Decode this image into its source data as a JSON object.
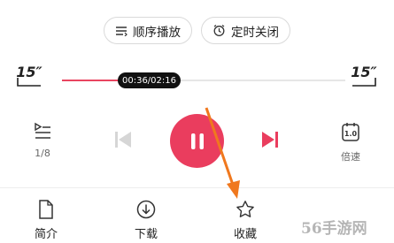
{
  "top_chips": {
    "order_label": "顺序播放",
    "timer_label": "定时关闭"
  },
  "player": {
    "skip_back_label": "15″",
    "skip_forward_label": "15″",
    "time_display": "00:36/02:16",
    "progress_fraction": 0.2647,
    "playlist_position": "1/8",
    "speed_icon_text": "1.0",
    "speed_label": "倍速"
  },
  "bottom_tabs": {
    "intro_label": "简介",
    "download_label": "下载",
    "favorite_label": "收藏"
  },
  "watermark": "56手游网",
  "colors": {
    "accent": "#ea3d5e",
    "arrow": "#f0781e"
  },
  "icons": {
    "order": "list-order-icon",
    "timer": "alarm-clock-icon",
    "playlist": "playlist-icon",
    "prev": "previous-track-icon",
    "pause": "pause-icon",
    "next": "next-track-icon",
    "speed": "speed-icon",
    "intro": "document-icon",
    "download": "download-icon",
    "favorite": "star-icon"
  }
}
